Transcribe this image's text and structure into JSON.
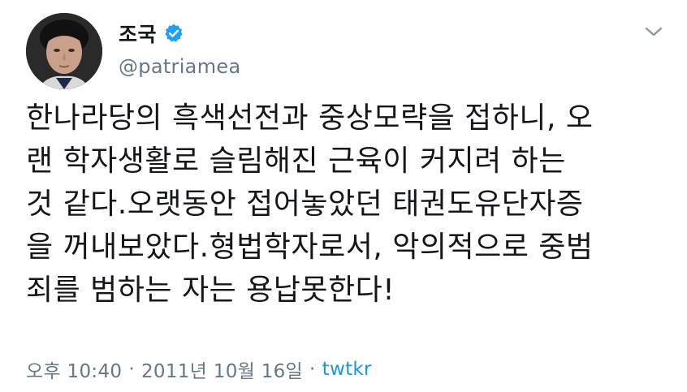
{
  "author": {
    "display_name": "조국",
    "handle": "@patriamea",
    "verified": true
  },
  "icons": {
    "verified": "verified-badge-icon",
    "menu": "chevron-down-icon",
    "avatar": "profile-photo"
  },
  "colors": {
    "verified_blue": "#1da1f2",
    "secondary_text": "#657786",
    "link": "#1b95e0",
    "primary_text": "#14171a"
  },
  "tweet": {
    "text": "한나라당의 흑색선전과 중상모략을 접하니, 오\n랜 학자생활로 슬림해진 근육이 커지려 하는\n것 같다.오랫동안 접어놓았던 태권도유단자증\n을 꺼내보았다.형법학자로서, 악의적으로 중범\n죄를 범하는 자는 용납못한다!",
    "time": "오후 10:40",
    "separator": "·",
    "date": "2011년 10월 16일",
    "source": "twtkr"
  }
}
